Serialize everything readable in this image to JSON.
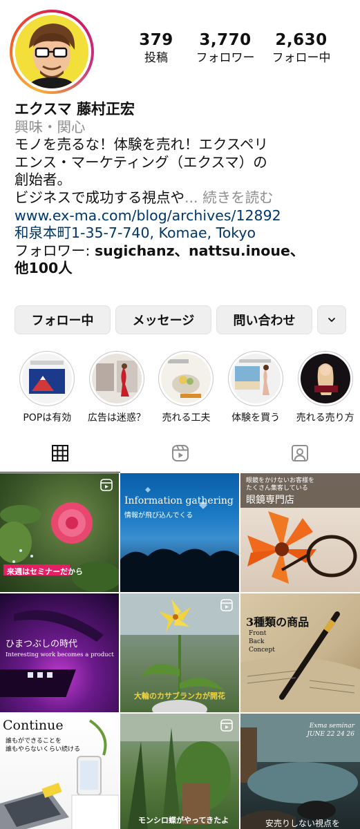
{
  "profile": {
    "stats": [
      {
        "value": "379",
        "label": "投稿"
      },
      {
        "value": "3,770",
        "label": "フォロワー"
      },
      {
        "value": "2,630",
        "label": "フォロー中"
      }
    ],
    "name": "エクスマ 藤村正宏",
    "category": "興味・関心",
    "bio_line1": "モノを売るな！体験を売れ！エクスペリ",
    "bio_line2": "エンス・マーケティング（エクスマ）の",
    "bio_line3": "創始者。",
    "bio_line4": "ビジネスで成功する視点や",
    "more": "... 続きを読む",
    "link": "www.ex-ma.com/blog/archives/12892",
    "address": "和泉本町1-35-7-740, Komae, Tokyo",
    "followed_prefix": "フォロワー: ",
    "followed_names": "sugichanz、nattsu.inoue、",
    "followed_suffix": "他100人"
  },
  "actions": {
    "following": "フォロー中",
    "message": "メッセージ",
    "contact": "問い合わせ"
  },
  "highlights": [
    {
      "label": "POPは有効"
    },
    {
      "label": "広告は迷惑？"
    },
    {
      "label": "売れる工夫"
    },
    {
      "label": "体験を買う"
    },
    {
      "label": "売れる売り方"
    }
  ],
  "tabs": [
    {
      "icon": "grid-icon"
    },
    {
      "icon": "reels-icon"
    },
    {
      "icon": "tagged-icon"
    }
  ],
  "posts": [
    {
      "text": "来週はセミナーだから"
    },
    {
      "text": "Information gathering",
      "sub": "情報が飛び込んでくる"
    },
    {
      "text": "眼鏡専門店",
      "sub": "眼鏡をかけないお客様を\nたくさん集客している"
    },
    {
      "text": "ひまつぶしの時代",
      "sub": "Interesting work becomes a product"
    },
    {
      "text": "大輪のカサブランカが開花"
    },
    {
      "text": "3種類の商品",
      "sub": "Front\nBack\nConcept"
    },
    {
      "text": "Continue",
      "sub": "誰もができることを\n誰もやらないくらい続ける"
    },
    {
      "text": "モンシロ蝶がやってきたよ"
    },
    {
      "text": "安売りしない視点を",
      "sub": "Exma seminar\nJUNE 22 24 26"
    }
  ],
  "colors": {
    "link": "#00376b",
    "muted": "#8e8e8e",
    "button_bg": "#efefef"
  }
}
